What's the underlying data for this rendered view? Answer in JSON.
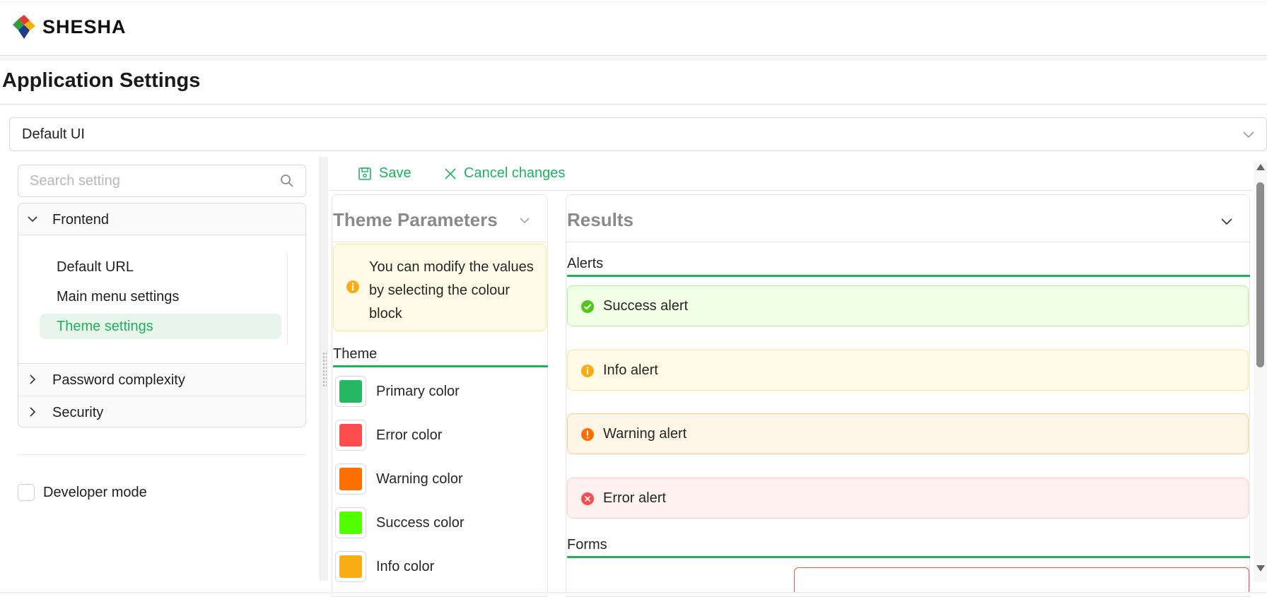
{
  "app": {
    "logo_text": "SHESHA",
    "logo_icon": "shesha-logo-icon"
  },
  "page": {
    "title": "Application Settings"
  },
  "ui_selector": {
    "value": "Default UI"
  },
  "search": {
    "placeholder": "Search setting",
    "icon": "search-icon"
  },
  "tree": {
    "frontend": {
      "label": "Frontend",
      "items": [
        {
          "label": "Default URL"
        },
        {
          "label": "Main menu settings"
        },
        {
          "label": "Theme settings",
          "active": true
        }
      ]
    },
    "password": {
      "label": "Password complexity"
    },
    "security": {
      "label": "Security"
    }
  },
  "developer_mode": {
    "label": "Developer mode",
    "checked": false
  },
  "toolbar": {
    "save_label": "Save",
    "cancel_label": "Cancel changes"
  },
  "theme_panel": {
    "title": "Theme Parameters",
    "info_text": "You can modify the values by selecting the colour block",
    "section_label": "Theme",
    "colors": [
      {
        "label": "Primary color",
        "hex": "#25b864"
      },
      {
        "label": "Error color",
        "hex": "#ff4d4f"
      },
      {
        "label": "Warning color",
        "hex": "#ff6f00"
      },
      {
        "label": "Success color",
        "hex": "#52ff00"
      },
      {
        "label": "Info color",
        "hex": "#faad14"
      }
    ]
  },
  "results_panel": {
    "title": "Results",
    "alerts_label": "Alerts",
    "alerts": {
      "success": "Success alert",
      "info": "Info alert",
      "warning": "Warning alert",
      "error": "Error alert"
    },
    "forms_label": "Forms"
  },
  "colors": {
    "accent": "#22b060",
    "info": "#faad14",
    "warning": "#ff6f00",
    "error": "#ff4d4f",
    "success": "#52ff00"
  }
}
